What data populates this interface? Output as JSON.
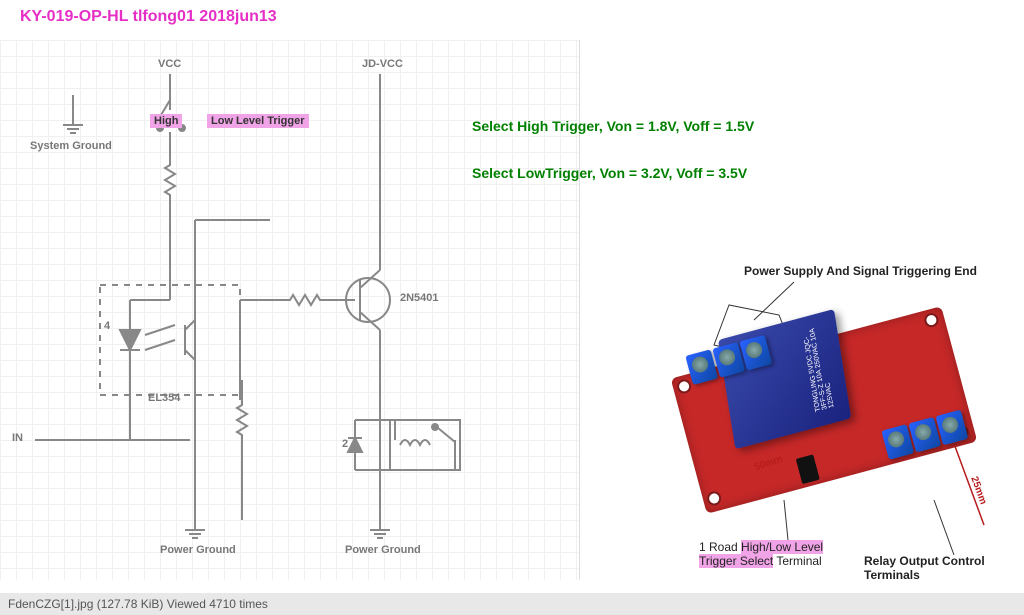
{
  "title": "KY-019-OP-HL tlfong01 2018jun13",
  "schematic": {
    "vcc": "VCC",
    "jdvcc": "JD-VCC",
    "system_ground": "System Ground",
    "high": "High",
    "low_level_trigger": "Low Level Trigger",
    "in": "IN",
    "power_ground_1": "Power Ground",
    "power_ground_2": "Power Ground",
    "opto": "EL354",
    "transistor": "2N5401",
    "pin4": "4",
    "pin2": "2"
  },
  "notes": {
    "high": "Select High Trigger, Von = 1.8V, Voff = 1.5V",
    "low": "Select LowTrigger, Von = 3.2V, Voff = 3.5V"
  },
  "photo": {
    "top_label": "Power Supply And Signal Triggering End",
    "jumper_label_1": "1 Road",
    "jumper_label_2": "High/Low Level",
    "jumper_label_3": "Trigger Select",
    "jumper_label_4": "Terminal",
    "output_label": "Relay Output Control Terminals",
    "dim_long": "50mm",
    "dim_short": "25mm",
    "relay_marking": "TONGLING 5VDC JQC-3FF-S-Z 10A 250VAC 10A 125VAC"
  },
  "footer": "FdenCZG[1].jpg (127.78 KiB) Viewed 4710 times"
}
